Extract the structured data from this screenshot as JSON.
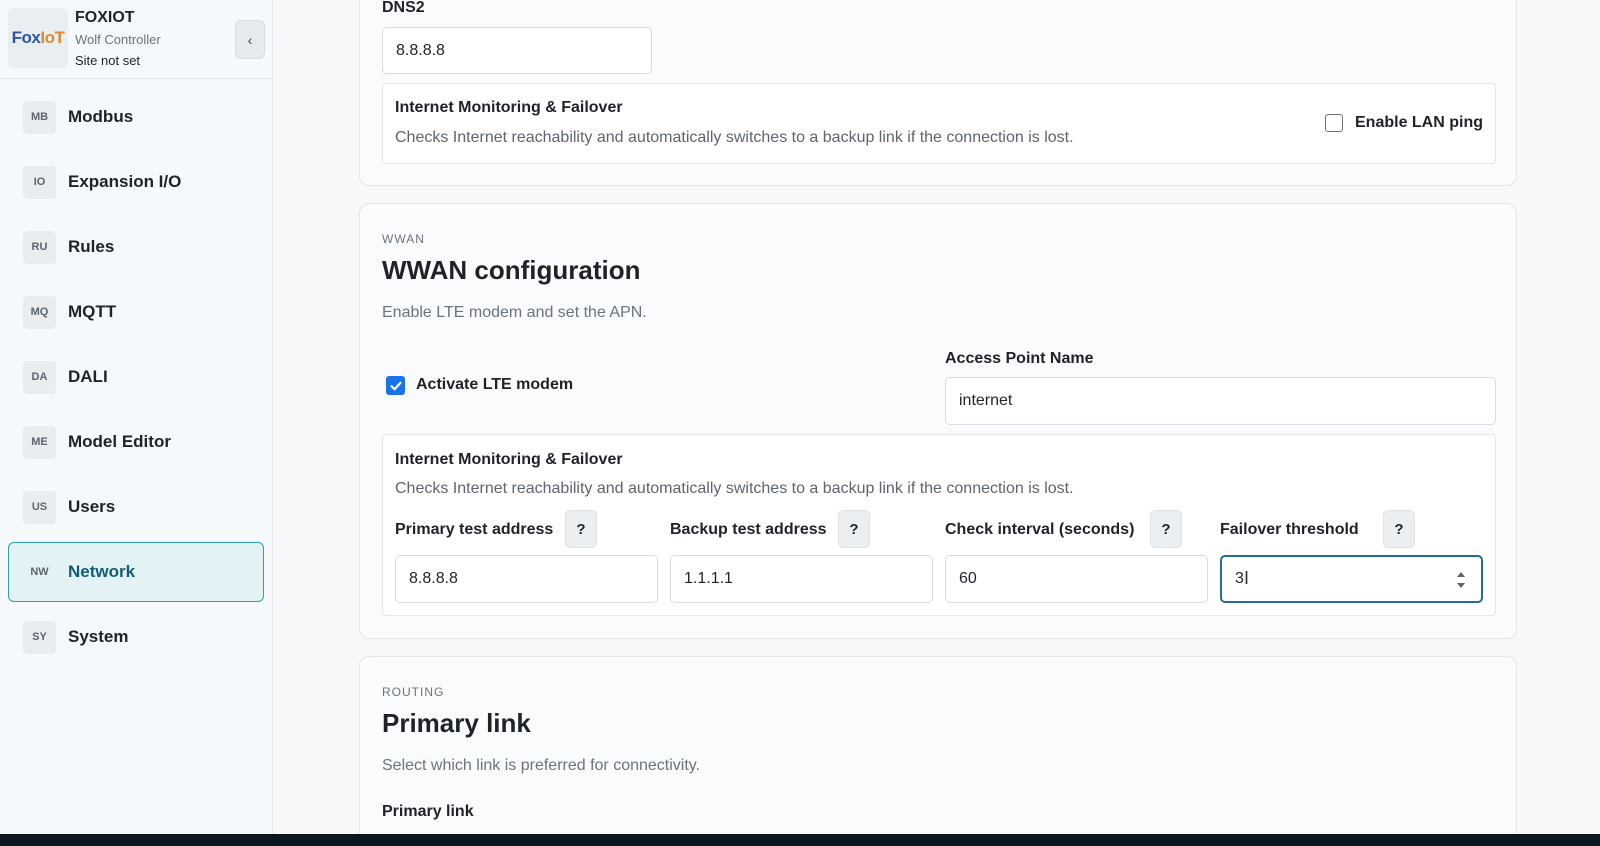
{
  "brand": {
    "logo_text_1": "Fox",
    "logo_text_2": "IoT",
    "name": "FOXIOT",
    "subtitle": "Wolf Controller",
    "site": "Site not set",
    "collapse_icon": "‹"
  },
  "sidebar": {
    "items": [
      {
        "abbr": "MB",
        "label": "Modbus"
      },
      {
        "abbr": "IO",
        "label": "Expansion I/O"
      },
      {
        "abbr": "RU",
        "label": "Rules"
      },
      {
        "abbr": "MQ",
        "label": "MQTT"
      },
      {
        "abbr": "DA",
        "label": "DALI"
      },
      {
        "abbr": "ME",
        "label": "Model Editor"
      },
      {
        "abbr": "US",
        "label": "Users"
      },
      {
        "abbr": "NW",
        "label": "Network",
        "active": true
      },
      {
        "abbr": "SY",
        "label": "System"
      }
    ]
  },
  "lan": {
    "dns2_label": "DNS2",
    "dns2_value": "8.8.8.8",
    "monitor_title": "Internet Monitoring & Failover",
    "monitor_desc": "Checks Internet reachability and automatically switches to a backup link if the connection is lost.",
    "enable_ping_label": "Enable LAN ping",
    "enable_ping_checked": false
  },
  "wwan": {
    "eyebrow": "WWAN",
    "title": "WWAN configuration",
    "desc": "Enable LTE modem and set the APN.",
    "activate_label": "Activate LTE modem",
    "activate_checked": true,
    "apn_label": "Access Point Name",
    "apn_value": "internet",
    "monitor_title": "Internet Monitoring & Failover",
    "monitor_desc": "Checks Internet reachability and automatically switches to a backup link if the connection is lost.",
    "help_label": "?",
    "fields": [
      {
        "label": "Primary test address",
        "value": "8.8.8.8"
      },
      {
        "label": "Backup test address",
        "value": "1.1.1.1"
      },
      {
        "label": "Check interval (seconds)",
        "value": "60"
      },
      {
        "label": "Failover threshold",
        "value": "3"
      }
    ]
  },
  "routing": {
    "eyebrow": "ROUTING",
    "title": "Primary link",
    "desc": "Select which link is preferred for connectivity.",
    "field_label": "Primary link"
  },
  "colors": {
    "accent": "#1a73e8",
    "active_nav_bg": "#e3f3f5",
    "active_nav_border": "#2aa0b0",
    "focus_border": "#1f6f9a"
  }
}
